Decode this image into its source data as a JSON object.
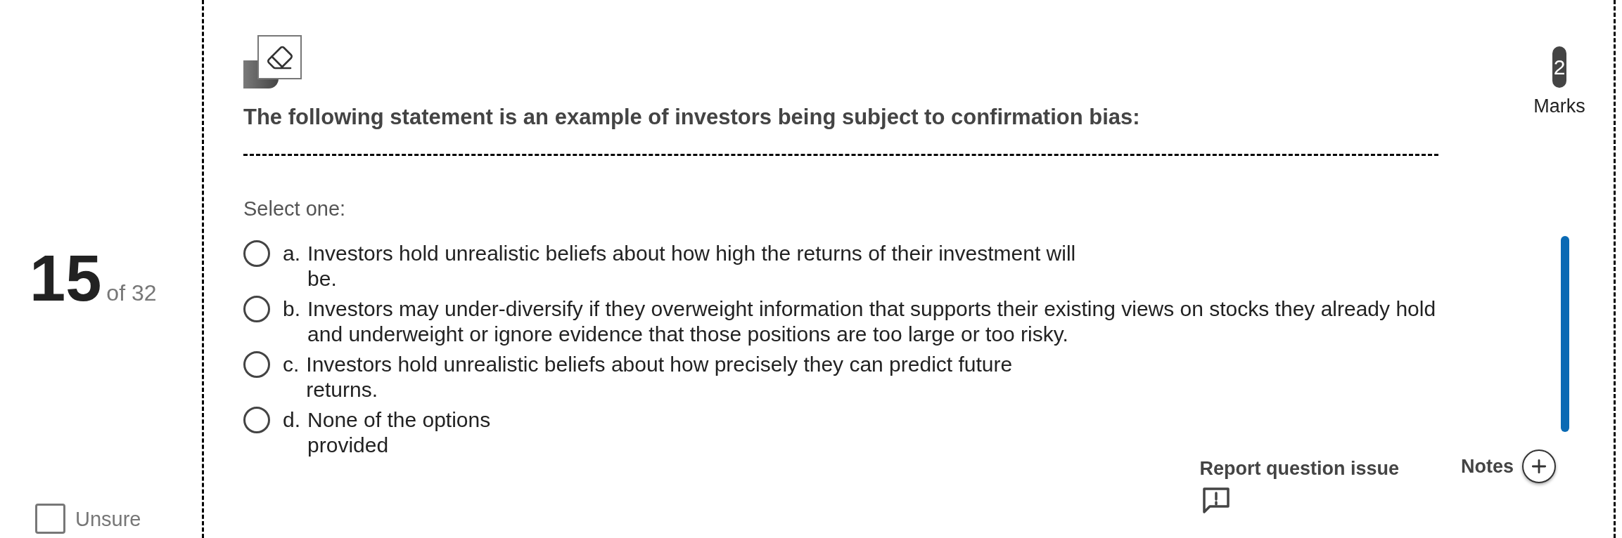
{
  "question_nav": {
    "number": "15",
    "total": "of 32"
  },
  "unsure": {
    "label": "Unsure",
    "checked": false
  },
  "question": {
    "text": "The following statement is an example of investors being subject to confirmation bias:",
    "marks": "2",
    "marks_label": "Marks"
  },
  "prompt": "Select one:",
  "options": [
    {
      "letter": "a.",
      "text": "Investors hold unrealistic beliefs about how high the returns of their investment will\nbe.",
      "selected": false
    },
    {
      "letter": "b.",
      "text": "Investors may under-diversify if they overweight information that supports their existing views on stocks they already hold\nand underweight or ignore evidence that those positions are too large or too risky.",
      "selected": false
    },
    {
      "letter": "c.",
      "text": "Investors hold unrealistic beliefs about how precisely they can predict future\nreturns.",
      "selected": false
    },
    {
      "letter": "d.",
      "text": "None of the options\nprovided",
      "selected": false
    }
  ],
  "footer": {
    "report_label": "Report question issue",
    "notes_label": "Notes"
  }
}
